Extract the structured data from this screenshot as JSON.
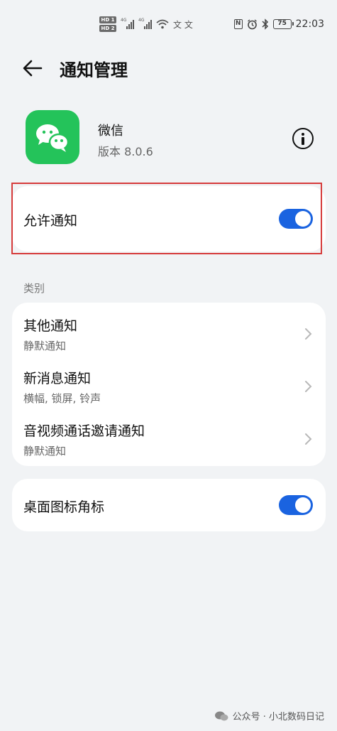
{
  "status_bar": {
    "sim1": "HD 1",
    "sim2": "HD 2",
    "network1": "4G",
    "network2": "4G",
    "extra_icons": "文 文",
    "nfc": "N",
    "battery": "75",
    "time": "22:03"
  },
  "header": {
    "title": "通知管理"
  },
  "app": {
    "name": "微信",
    "version": "版本 8.0.6"
  },
  "allow_notifications": {
    "label": "允许通知",
    "enabled": true
  },
  "categories": {
    "section_label": "类别",
    "items": [
      {
        "title": "其他通知",
        "subtitle": "静默通知"
      },
      {
        "title": "新消息通知",
        "subtitle": "横幅, 锁屏, 铃声"
      },
      {
        "title": "音视频通话邀请通知",
        "subtitle": "静默通知"
      }
    ]
  },
  "badge_setting": {
    "label": "桌面图标角标",
    "enabled": true
  },
  "watermark": {
    "text": "公众号 · 小北数码日记"
  },
  "colors": {
    "toggle_on": "#1a63e0",
    "app_icon": "#24c35a",
    "highlight_border": "#d63b3b",
    "background": "#f1f3f5"
  }
}
